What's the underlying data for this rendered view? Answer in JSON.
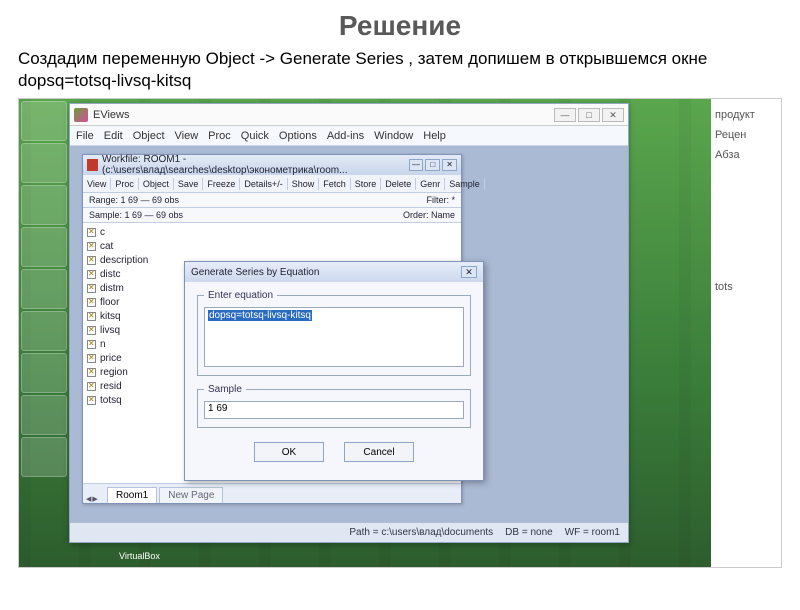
{
  "slide": {
    "title": "Решение",
    "description": "Создадим переменную Object -> Generate Series , затем допишем в открывшемся окне dopsq=totsq-livsq-kitsq"
  },
  "right_strip": {
    "items": [
      "продукт",
      "Рецен",
      "Абза",
      "tots"
    ]
  },
  "app": {
    "title": "EViews",
    "menu": [
      "File",
      "Edit",
      "Object",
      "View",
      "Proc",
      "Quick",
      "Options",
      "Add-ins",
      "Window",
      "Help"
    ],
    "status": {
      "path": "Path = c:\\users\\влад\\documents",
      "db": "DB = none",
      "wf": "WF = room1"
    }
  },
  "workfile": {
    "title": "Workfile: ROOM1 - (c:\\users\\влад\\searches\\desktop\\эконометрика\\room...",
    "toolbar": [
      "View",
      "Proc",
      "Object",
      "Save",
      "Freeze",
      "Details+/-",
      "Show",
      "Fetch",
      "Store",
      "Delete",
      "Genr",
      "Sample"
    ],
    "info": {
      "range": "Range: 1 69   —   69 obs",
      "filter": "Filter: *",
      "sample": "Sample: 1 69   —   69 obs",
      "order": "Order: Name"
    },
    "items": [
      "c",
      "cat",
      "description",
      "distc",
      "distm",
      "floor",
      "kitsq",
      "livsq",
      "n",
      "price",
      "region",
      "resid",
      "totsq"
    ],
    "tabs": {
      "active": "Room1",
      "inactive": "New Page"
    }
  },
  "dialog": {
    "title": "Generate Series by Equation",
    "equation_legend": "Enter equation",
    "equation": "dopsq=totsq-livsq-kitsq",
    "sample_legend": "Sample",
    "sample": "1 69",
    "ok": "OK",
    "cancel": "Cancel"
  },
  "taskbar": {
    "vb": "VirtualBox"
  }
}
